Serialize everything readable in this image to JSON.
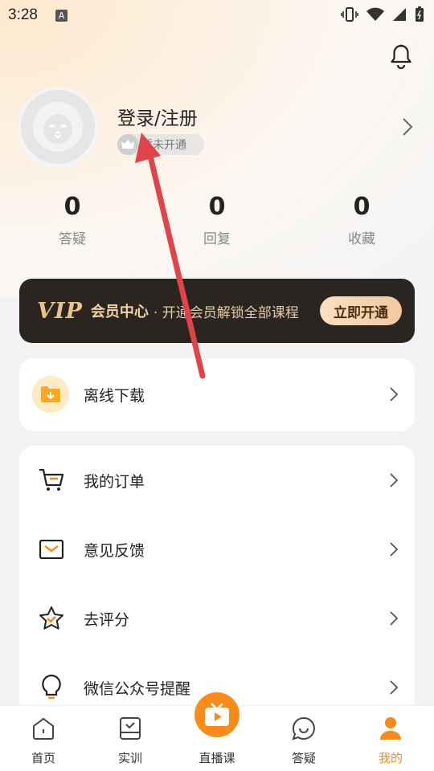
{
  "status": {
    "time": "3:28",
    "a_icon": "A"
  },
  "profile": {
    "title": "登录/注册",
    "vip_badge": "暂未开通"
  },
  "stats": [
    {
      "num": "0",
      "label": "答疑"
    },
    {
      "num": "0",
      "label": "回复"
    },
    {
      "num": "0",
      "label": "收藏"
    }
  ],
  "vip": {
    "logo": "VIP",
    "title": "会员中心",
    "subtitle": "· 开通会员解锁全部课程",
    "button": "立即开通"
  },
  "menu1": [
    {
      "label": "离线下载",
      "icon": "download-folder-icon"
    }
  ],
  "menu2": [
    {
      "label": "我的订单",
      "icon": "cart-icon"
    },
    {
      "label": "意见反馈",
      "icon": "envelope-icon"
    },
    {
      "label": "去评分",
      "icon": "star-icon"
    },
    {
      "label": "微信公众号提醒",
      "icon": "lightbulb-icon"
    }
  ],
  "tabs": [
    {
      "label": "首页",
      "icon": "home-icon"
    },
    {
      "label": "实训",
      "icon": "training-icon"
    },
    {
      "label": "直播课",
      "icon": "live-tv-icon"
    },
    {
      "label": "答疑",
      "icon": "chat-icon"
    },
    {
      "label": "我的",
      "icon": "user-icon",
      "active": true
    }
  ],
  "colors": {
    "accent": "#f5891b",
    "vip_gold": "#e9c38f",
    "annotation_arrow": "#e0434a"
  }
}
